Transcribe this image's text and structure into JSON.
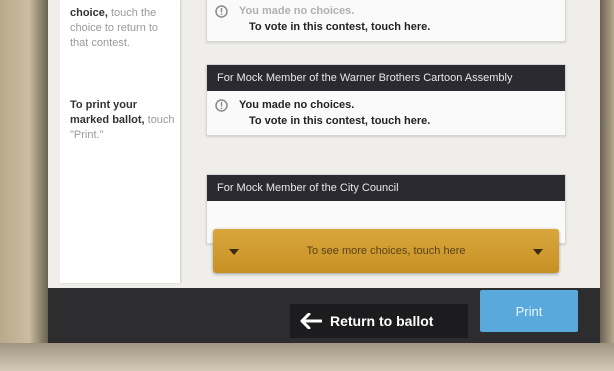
{
  "sidebar": {
    "instruction1_bold": "choice,",
    "instruction1_rest": " touch the choice to return to that contest.",
    "instruction2_bold": "To print your marked ballot,",
    "instruction2_rest": " touch \"Print.\""
  },
  "contests": [
    {
      "header": "",
      "status": "You made no choices.",
      "action": "To vote in this contest, touch here."
    },
    {
      "header": "For Mock Member of the Warner Brothers Cartoon Assembly",
      "status": "You made no choices.",
      "action": "To vote in this contest, touch here."
    },
    {
      "header": "For Mock Member of the City Council",
      "status": "",
      "action": ""
    }
  ],
  "more_bar": {
    "label": "To see more choices, touch here"
  },
  "footer": {
    "return_label": "Return to ballot",
    "print_label": "Print"
  },
  "colors": {
    "header_bg": "#2a2a30",
    "more_bar": "#d9a73d",
    "print_button": "#5aa9dc"
  },
  "icons": {
    "status": "info-circle-icon",
    "return": "arrow-left-icon",
    "more": "triangle-down-icon"
  }
}
